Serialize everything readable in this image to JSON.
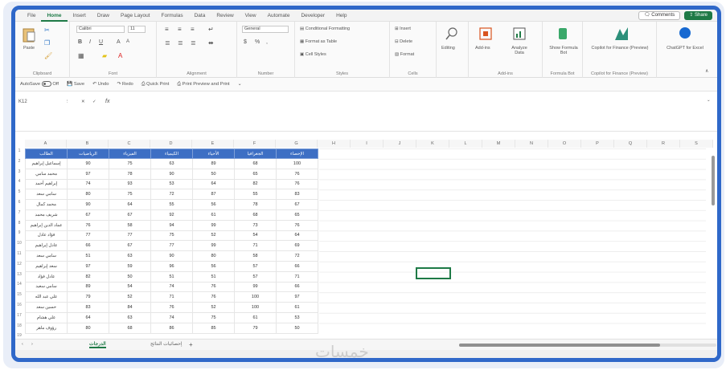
{
  "menu": {
    "tabs": [
      "File",
      "Home",
      "Insert",
      "Draw",
      "Page Layout",
      "Formulas",
      "Data",
      "Review",
      "View",
      "Automate",
      "Developer",
      "Help"
    ],
    "active_tab": "Home",
    "comments_label": "Comments",
    "share_label": "Share"
  },
  "ribbon": {
    "clipboard": {
      "paste": "Paste",
      "label": "Clipboard"
    },
    "font": {
      "name": "Calibri",
      "size": "11",
      "label": "Font"
    },
    "alignment": {
      "label": "Alignment"
    },
    "number": {
      "format": "General",
      "label": "Number"
    },
    "styles": {
      "conditional": "Conditional Formatting",
      "table": "Format as Table",
      "cell": "Cell Styles",
      "label": "Styles"
    },
    "cells": {
      "insert": "Insert",
      "delete": "Delete",
      "format": "Format",
      "label": "Cells"
    },
    "editing": {
      "label": "Editing"
    },
    "addins": {
      "addins": "Add-ins",
      "analyze": "Analyze Data",
      "label": "Add-ins"
    },
    "formula_bot": {
      "show": "Show Formula Bot",
      "label": "Formula Bot"
    },
    "copilot": {
      "btn": "Copilot for Finance (Preview)",
      "label": "Copilot for Finance (Preview)"
    },
    "chatgpt": {
      "btn": "ChatGPT for Excel"
    }
  },
  "qat": {
    "autosave": "AutoSave",
    "autosave_state": "Off",
    "save": "Save",
    "undo": "Undo",
    "redo": "Redo",
    "quick_print": "Quick Print",
    "print_preview": "Print Preview and Print"
  },
  "formula_bar": {
    "name_box": "K12",
    "fx": "fx"
  },
  "grid": {
    "columns": [
      "A",
      "B",
      "C",
      "D",
      "E",
      "F",
      "G",
      "H",
      "I",
      "J",
      "K",
      "L",
      "M",
      "N",
      "O",
      "P",
      "Q",
      "R",
      "S"
    ],
    "rows": [
      "1",
      "2",
      "3",
      "4",
      "5",
      "6",
      "7",
      "8",
      "9",
      "10",
      "11",
      "12",
      "13",
      "14",
      "15",
      "16",
      "17",
      "18",
      "19"
    ],
    "headers": [
      "الطالب",
      "الرياضيات",
      "الفيزياء",
      "الكيمياء",
      "الأحياء",
      "الجغرافيا",
      "الإحصاء"
    ],
    "data": [
      [
        "إسماعيل إبراهيم",
        "90",
        "75",
        "63",
        "89",
        "68",
        "100"
      ],
      [
        "محمد سامي",
        "97",
        "78",
        "90",
        "50",
        "65",
        "76"
      ],
      [
        "إبراهيم أحمد",
        "74",
        "93",
        "53",
        "64",
        "82",
        "76"
      ],
      [
        "سامي سعد",
        "80",
        "75",
        "72",
        "87",
        "55",
        "83"
      ],
      [
        "محمد كمال",
        "90",
        "64",
        "55",
        "56",
        "78",
        "67"
      ],
      [
        "شريف محمد",
        "67",
        "67",
        "92",
        "61",
        "68",
        "65"
      ],
      [
        "عماد الدين إبراهيم",
        "76",
        "58",
        "94",
        "99",
        "73",
        "76"
      ],
      [
        "فؤاد عادل",
        "77",
        "77",
        "75",
        "52",
        "54",
        "64"
      ],
      [
        "عادل إبراهيم",
        "66",
        "67",
        "77",
        "99",
        "71",
        "69"
      ],
      [
        "سامي سعد",
        "51",
        "63",
        "90",
        "80",
        "58",
        "72"
      ],
      [
        "سعد إبراهيم",
        "97",
        "59",
        "96",
        "56",
        "57",
        "66"
      ],
      [
        "عادل فؤاد",
        "82",
        "50",
        "51",
        "51",
        "57",
        "71"
      ],
      [
        "سامي سعيد",
        "89",
        "54",
        "74",
        "76",
        "99",
        "66"
      ],
      [
        "علي عبد الله",
        "79",
        "52",
        "71",
        "76",
        "100",
        "97"
      ],
      [
        "حسين سعد",
        "83",
        "84",
        "76",
        "52",
        "100",
        "61"
      ],
      [
        "علي هشام",
        "64",
        "63",
        "74",
        "75",
        "61",
        "53"
      ],
      [
        "رؤوف ماهر",
        "80",
        "68",
        "86",
        "85",
        "79",
        "50"
      ]
    ],
    "selected_cell": "K12"
  },
  "sheets": {
    "tabs": [
      "الدرجات",
      "إحصائيات النتائج"
    ],
    "active": "الدرجات",
    "add": "+"
  },
  "watermark": "خمسات",
  "colors": {
    "accent": "#1e7a46",
    "table_header": "#3d6fc4",
    "frame": "#2f68c9"
  }
}
